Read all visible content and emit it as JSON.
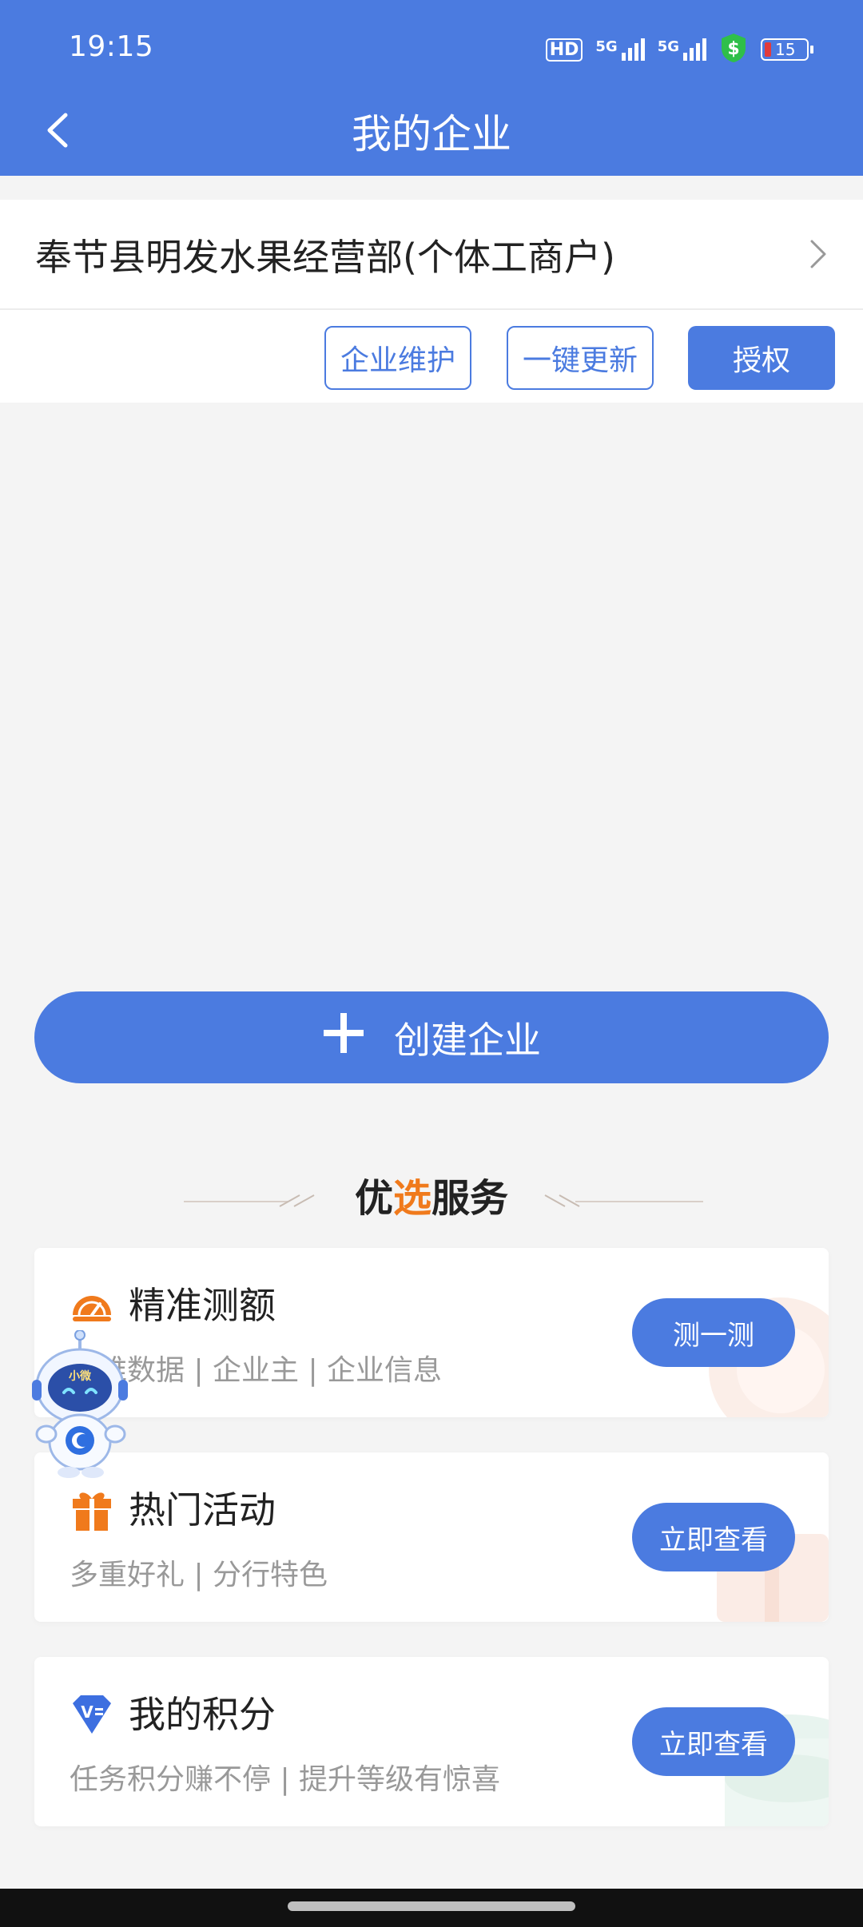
{
  "status_bar": {
    "time": "19:15",
    "battery": "15",
    "signal_label_1": "5G",
    "signal_label_2": "5G",
    "hd_label": "HD"
  },
  "nav": {
    "title": "我的企业"
  },
  "company": {
    "name": "奉节县明发水果经营部(个体工商户)"
  },
  "actions": {
    "maintain": "企业维护",
    "update": "一键更新",
    "authorize": "授权"
  },
  "create": {
    "label": "创建企业"
  },
  "section": {
    "title_part1": "优",
    "title_part2": "选",
    "title_part3": "服务"
  },
  "services": [
    {
      "title": "精准测额",
      "subtitle": "多维数据 | 企业主 | 企业信息",
      "button": "测一测",
      "icon": "speedometer-icon"
    },
    {
      "title": "热门活动",
      "subtitle": "多重好礼 | 分行特色",
      "button": "立即查看",
      "icon": "gift-icon"
    },
    {
      "title": "我的积分",
      "subtitle": "任务积分赚不停 | 提升等级有惊喜",
      "button": "立即查看",
      "icon": "v-points-icon"
    }
  ],
  "mascot_label": "小微",
  "colors": {
    "primary": "#4b7be0",
    "accent_orange": "#f07a1c"
  }
}
